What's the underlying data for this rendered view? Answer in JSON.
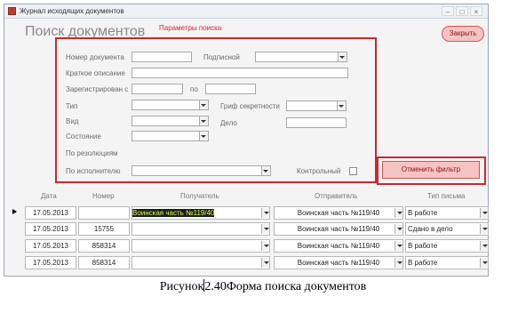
{
  "window": {
    "title": "Журнал исходящих документов",
    "minimize": "–",
    "maximize": "□",
    "close": "×"
  },
  "form": {
    "title": "Поиск документов",
    "params_title": "Параметры поиска",
    "close_button": "Закрыть",
    "reset_filter_button": "Отменить фильтр"
  },
  "params": {
    "doc_number": "Номер документа",
    "signed_by": "Подписной",
    "short_desc": "Краткое описание",
    "registered_from": "Зарегистрирован с",
    "registered_to": "по",
    "type": "Тип",
    "secrecy": "Гриф секретности",
    "kind": "Вид",
    "case": "Дело",
    "state": "Состояние",
    "by_resolutions": "По резолюциям",
    "by_executor": "По исполнителю",
    "control": "Контрольный"
  },
  "table": {
    "headers": [
      "Дата",
      "Номер",
      "Получатель",
      "Отправитель",
      "Тип письма"
    ],
    "rows": [
      {
        "date": "17.05.2013",
        "number": "",
        "recipient": "Воинская часть №119/40",
        "sender": "Воинская часть №119/40",
        "type": "В работе"
      },
      {
        "date": "17.05.2013",
        "number": "15755",
        "recipient": "",
        "sender": "Воинская часть №119/40",
        "type": "Сдано в дело"
      },
      {
        "date": "17.05.2013",
        "number": "858314",
        "recipient": "",
        "sender": "Воинская часть №119/40",
        "type": "В работе"
      },
      {
        "date": "17.05.2013",
        "number": "858314",
        "recipient": "",
        "sender": "Воинская часть №119/40",
        "type": "В работе"
      }
    ]
  },
  "caption": {
    "prefix": "Рисунок",
    "suffix": "2.40Форма поиска документов"
  },
  "colors": {
    "highlight_red": "#d6232d",
    "button_pink": "#f6c2c2"
  }
}
